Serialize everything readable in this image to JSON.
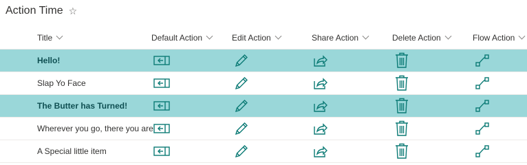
{
  "header": {
    "list_title": "Action Time",
    "favorite_icon": "star-outline-icon"
  },
  "columns": [
    "Title",
    "Default Action",
    "Edit Action",
    "Share Action",
    "Delete Action",
    "Flow Action"
  ],
  "rows": [
    {
      "title": "Hello!",
      "highlighted": true
    },
    {
      "title": "Slap Yo Face",
      "highlighted": false
    },
    {
      "title": "The Butter has Turned!",
      "highlighted": true
    },
    {
      "title": "Wherever you go, there you are",
      "highlighted": false
    },
    {
      "title": "A Special little item",
      "highlighted": false
    }
  ],
  "colors": {
    "accent": "#0b7a75",
    "highlight_row": "#9ad7d9"
  },
  "icons": {
    "default": "open-in-panel-icon",
    "edit": "pencil-icon",
    "share": "share-icon",
    "delete": "trash-icon",
    "flow": "flow-icon",
    "chevron": "chevron-down-icon"
  }
}
